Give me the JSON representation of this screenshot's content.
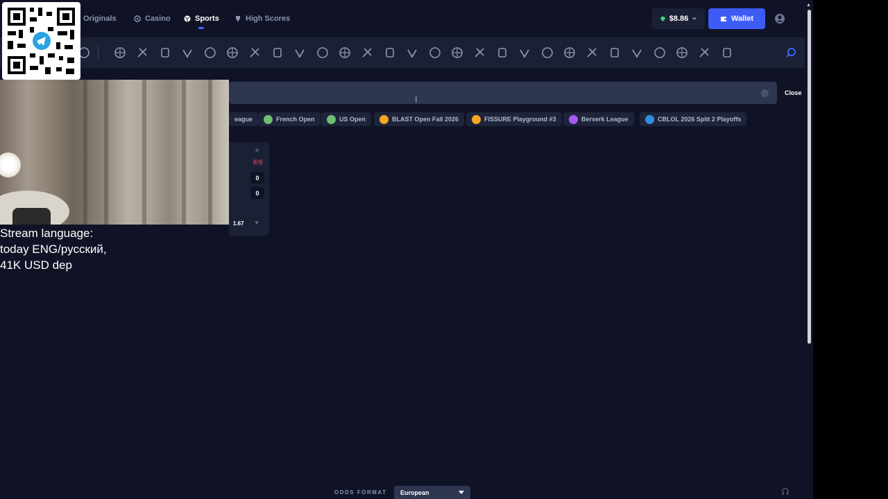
{
  "nav": {
    "tabs": [
      {
        "label": "Originals",
        "icon": "dice-icon",
        "active": false
      },
      {
        "label": "Casino",
        "icon": "casino-chip-icon",
        "active": false
      },
      {
        "label": "Sports",
        "icon": "ball-icon",
        "active": true
      },
      {
        "label": "High Scores",
        "icon": "trophy-icon",
        "active": false
      }
    ],
    "balance": "$8.86",
    "wallet_label": "Wallet"
  },
  "sports_bar": {
    "icons": [
      "basketball-hoop-icon",
      "soccer-icon",
      "basketball-icon",
      "tennis-icon",
      "counter-strike-icon",
      "dota-icon",
      "league-of-legends-icon",
      "valorant-icon",
      "esport-generic-icon",
      "baseball-bat-icon",
      "table-tennis-icon",
      "badminton-icon",
      "volleyball-icon",
      "dartboard-icon",
      "cricket-icon",
      "rugby-icon",
      "mma-icon",
      "handball-icon",
      "ice-hockey-icon",
      "world-soccer-icon",
      "world-globe-icon",
      "bowling-icon",
      "globe-ball-icon",
      "skiing-icon",
      "golf-icon",
      "racing-icon",
      "horse-racing-icon",
      "shop-icon",
      "more-sports-icon"
    ],
    "search_icon": "search-icon"
  },
  "search": {
    "value": "",
    "placeholder": "",
    "close_label": "Close"
  },
  "chips": [
    {
      "label": "eague",
      "color": "#3d8bff"
    },
    {
      "label": "French Open",
      "color": "#6fbf73"
    },
    {
      "label": "US Open",
      "color": "#6fbf73"
    },
    {
      "label": "BLAST Open Fall 2026",
      "color": "#f5a623"
    },
    {
      "label": "FISSURE Playground #3",
      "color": "#f5a623"
    },
    {
      "label": "Berserk League",
      "color": "#a35cf5"
    },
    {
      "label": "CBLOL 2026 Split 2 Playoffs",
      "color": "#2f8ee0"
    }
  ],
  "event": {
    "score_home": "0",
    "score_away": "0",
    "odds": "1.67"
  },
  "overlay": {
    "lines": [
      "Stream language:",
      "today ENG/русский,",
      "41K USD dep"
    ]
  },
  "footer": {
    "odds_format_label": "ODDS FORMAT",
    "odds_format_value": "European"
  },
  "colors": {
    "background": "#0f1325",
    "accent": "#3d5cf5",
    "live": "#ff3b5c"
  }
}
